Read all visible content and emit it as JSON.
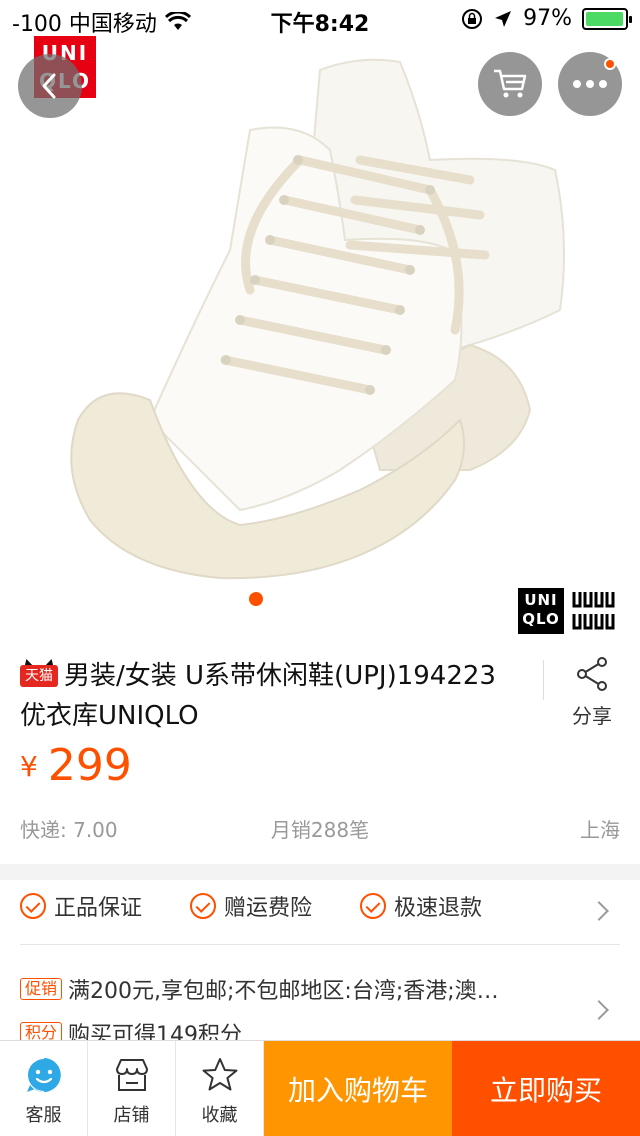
{
  "status_bar": {
    "carrier": "-100 中国移动",
    "time": "下午8:42",
    "battery": "97%",
    "battery_level": 0.97
  },
  "hero": {
    "logo_top": "UNI QLO",
    "logo_bottom": "UNI QLO",
    "gallery_current_page": 1
  },
  "product": {
    "store_badge": "天猫",
    "title": "男装/女装 U系带休闲鞋(UPJ)194223 优衣库UNIQLO",
    "share_label": "分享",
    "currency_symbol": "¥",
    "price": "299",
    "shipping": "快递: 7.00",
    "monthly_sales": "月销288笔",
    "location": "上海"
  },
  "guarantees": [
    {
      "label": "正品保证"
    },
    {
      "label": "赠运费险"
    },
    {
      "label": "极速退款"
    }
  ],
  "promotions": [
    {
      "tag": "促销",
      "text": "满200元,享包邮;不包邮地区:台湾;香港;澳…"
    },
    {
      "tag": "积分",
      "text": "购买可得149积分"
    }
  ],
  "bottom_bar": {
    "service_label": "客服",
    "store_label": "店铺",
    "favorite_label": "收藏",
    "add_to_cart_label": "加入购物车",
    "buy_now_label": "立即购买"
  },
  "colors": {
    "accent": "#ff5000",
    "cart_button": "#ff9500",
    "uniqlo_red": "#e60012"
  },
  "icons": [
    "wifi-icon",
    "lock-rotation-icon",
    "location-arrow-icon",
    "battery-icon",
    "back-chevron-icon",
    "cart-icon",
    "more-icon",
    "share-icon",
    "check-circle-icon",
    "chevron-right-icon",
    "service-face-icon",
    "store-icon",
    "star-icon"
  ]
}
